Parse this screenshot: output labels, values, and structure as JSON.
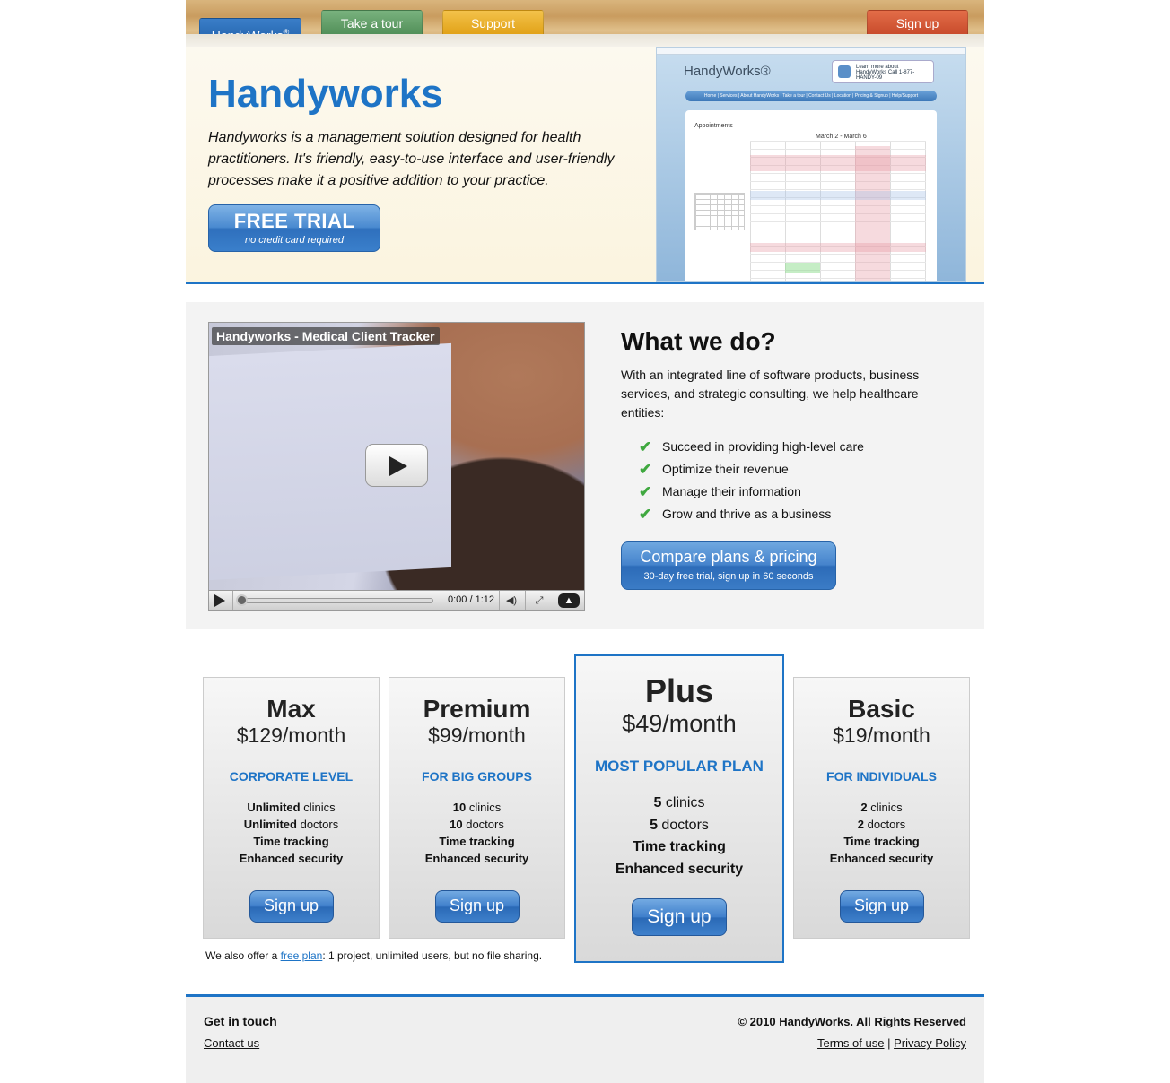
{
  "nav": {
    "logo": "HandyWorks",
    "logo_mark": "®",
    "tour": "Take a tour",
    "support": "Support",
    "signup": "Sign up"
  },
  "hero": {
    "title": "Handyworks",
    "description": "Handyworks is a management solution designed for health practitioners. It's friendly, easy-to-use interface and user-friendly processes make it a positive addition to your practice.",
    "cta_main": "FREE TRIAL",
    "cta_sub": "no credit card required",
    "screenshot": {
      "logo": "HandyWorks®",
      "phone": "Learn more about HandyWorks Call 1-877-HANDY-09",
      "nav": "Home | Services | About HandyWorks | Take a tour | Contact Us | Location | Pricing & Signup | Help/Support",
      "title": "Appointments",
      "range": "March 2 - March 6"
    }
  },
  "video": {
    "title": "Handyworks - Medical Client Tracker",
    "time": "0:00 / 1:12",
    "progress": 0.0
  },
  "what": {
    "title": "What we do?",
    "description": "With an integrated line of software products, business services, and strategic consulting, we help healthcare entities:",
    "items": [
      "Succeed in providing high-level care",
      "Optimize their revenue",
      "Manage their information",
      "Grow and thrive as a business"
    ],
    "cta_main": "Compare plans & pricing",
    "cta_sub": "30-day free trial, sign up in 60 seconds"
  },
  "plans": [
    {
      "name": "Max",
      "price": "$129/month",
      "level": "CORPORATE LEVEL",
      "clinics_b": "Unlimited",
      "clinics": " clinics",
      "doctors_b": "Unlimited",
      "doctors": " doctors",
      "f3": "Time tracking",
      "f4": "Enhanced security",
      "button": "Sign up"
    },
    {
      "name": "Premium",
      "price": "$99/month",
      "level": "FOR BIG GROUPS",
      "clinics_b": "10",
      "clinics": " clinics",
      "doctors_b": "10",
      "doctors": " doctors",
      "f3": "Time tracking",
      "f4": "Enhanced security",
      "button": "Sign up"
    },
    {
      "name": "Plus",
      "price": "$49/month",
      "level": "MOST POPULAR PLAN",
      "clinics_b": "5",
      "clinics": " clinics",
      "doctors_b": "5",
      "doctors": " doctors",
      "f3": "Time tracking",
      "f4": "Enhanced security",
      "button": "Sign up"
    },
    {
      "name": "Basic",
      "price": "$19/month",
      "level": "FOR INDIVIDUALS",
      "clinics_b": "2",
      "clinics": " clinics",
      "doctors_b": "2",
      "doctors": " doctors",
      "f3": "Time tracking",
      "f4": "Enhanced security",
      "button": "Sign up"
    }
  ],
  "free_note": {
    "before": "We also offer a ",
    "link": "free plan",
    "after": ": 1 project, unlimited users, but no file sharing."
  },
  "footer": {
    "heading": "Get in touch",
    "contact": "Contact us",
    "copyright": "© 2010 HandyWorks. All Rights Reserved",
    "terms": "Terms of use",
    "sep": " | ",
    "privacy": "Privacy Policy"
  },
  "colors": {
    "accent": "#1e74c6",
    "tour_tab": "#5f9c65",
    "support_tab": "#e8ae22",
    "signup_tab": "#d35734"
  }
}
